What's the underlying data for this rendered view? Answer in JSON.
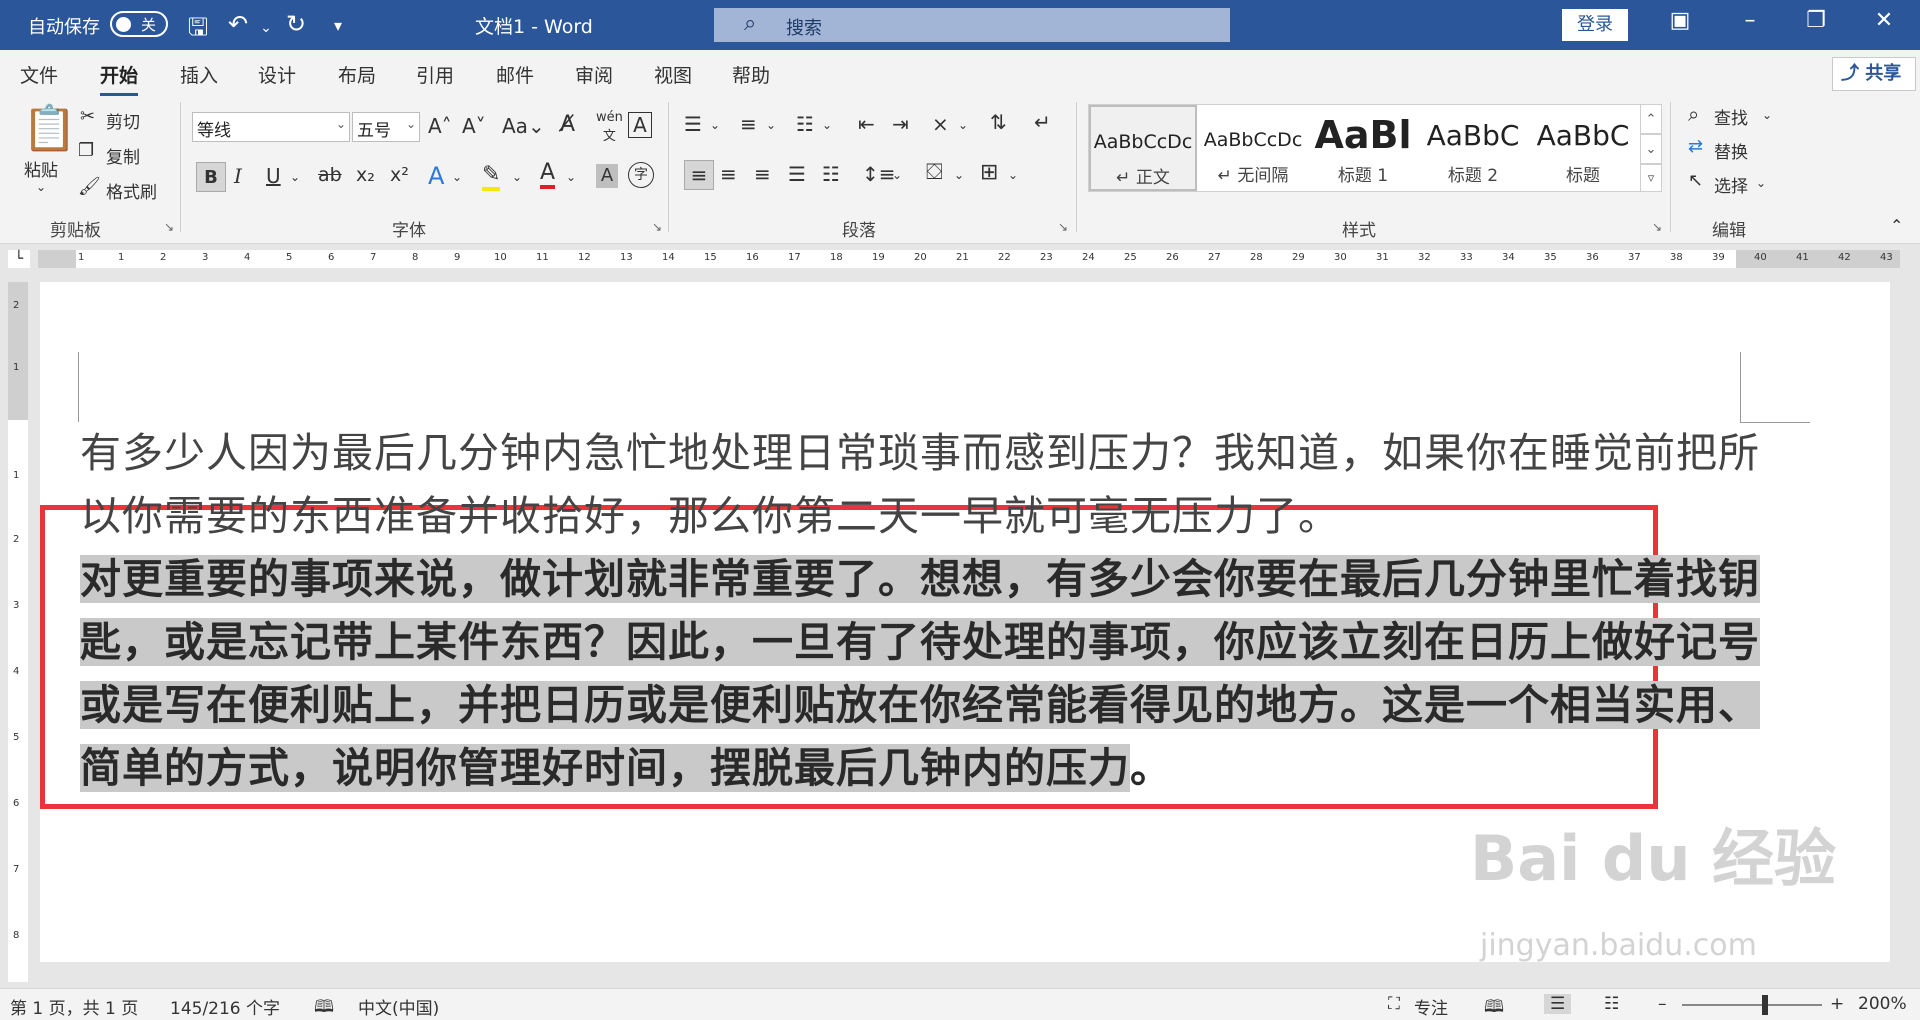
{
  "titlebar": {
    "autosave_label": "自动保存",
    "toggle_state": "关",
    "doc_title": "文档1  -  Word",
    "search_placeholder": "搜索",
    "login": "登录"
  },
  "tabs": [
    {
      "label": "文件"
    },
    {
      "label": "开始"
    },
    {
      "label": "插入"
    },
    {
      "label": "设计"
    },
    {
      "label": "布局"
    },
    {
      "label": "引用"
    },
    {
      "label": "邮件"
    },
    {
      "label": "审阅"
    },
    {
      "label": "视图"
    },
    {
      "label": "帮助"
    }
  ],
  "share": "共享",
  "clipboard": {
    "paste": "粘贴",
    "cut": "剪切",
    "copy": "复制",
    "format_painter": "格式刷",
    "label": "剪贴板"
  },
  "font": {
    "name": "等线",
    "size": "五号",
    "label": "字体"
  },
  "paragraph": {
    "label": "段落"
  },
  "styles": {
    "label": "样式",
    "items": [
      {
        "sample": "AaBbCcDc",
        "name": "↵ 正文"
      },
      {
        "sample": "AaBbCcDc",
        "name": "↵ 无间隔"
      },
      {
        "sample": "AaBl",
        "name": "标题 1"
      },
      {
        "sample": "AaBbC",
        "name": "标题 2"
      },
      {
        "sample": "AaBbC",
        "name": "标题"
      }
    ]
  },
  "editing": {
    "find": "查找",
    "replace": "替换",
    "select": "选择",
    "label": "编辑"
  },
  "ruler": {
    "ticks": [
      "1",
      "1",
      "2",
      "3",
      "4",
      "5",
      "6",
      "7",
      "8",
      "9",
      "10",
      "11",
      "12",
      "13",
      "14",
      "15",
      "16",
      "17",
      "18",
      "19",
      "20",
      "21",
      "22",
      "23",
      "24",
      "25",
      "26",
      "27",
      "28",
      "29",
      "30",
      "31",
      "32",
      "33",
      "34",
      "35",
      "36",
      "37",
      "38",
      "39",
      "40",
      "41",
      "42",
      "43"
    ]
  },
  "vruler": {
    "ticks": [
      "2",
      "1",
      "1",
      "2",
      "3",
      "4",
      "5",
      "6",
      "7",
      "8"
    ]
  },
  "document": {
    "para1": "有多少人因为最后几分钟内急忙地处理日常琐事而感到压力？我知道，如果你在睡觉前把所以你需要的东西准备并收拾好，那么你第二天一早就可毫无压力了。",
    "para2": "对更重要的事项来说，做计划就非常重要了。想想，有多少会你要在最后几分钟里忙着找钥匙，或是忘记带上某件东西？因此，一旦有了待处理的事项，你应该立刻在日历上做好记号或是写在便利贴上，并把日历或是便利贴放在你经常能看得见的地方。这是一个相当实用、简单的方式，说明你管理好时间，摆脱最后几钟内的压力",
    "para2_end": "。"
  },
  "watermark": {
    "main": "Bai du 经验",
    "sub": "jingyan.baidu.com"
  },
  "status": {
    "page": "第 1 页，共 1 页",
    "words": "145/216 个字",
    "lang": "中文(中国)",
    "focus": "专注",
    "zoom": "200%"
  }
}
